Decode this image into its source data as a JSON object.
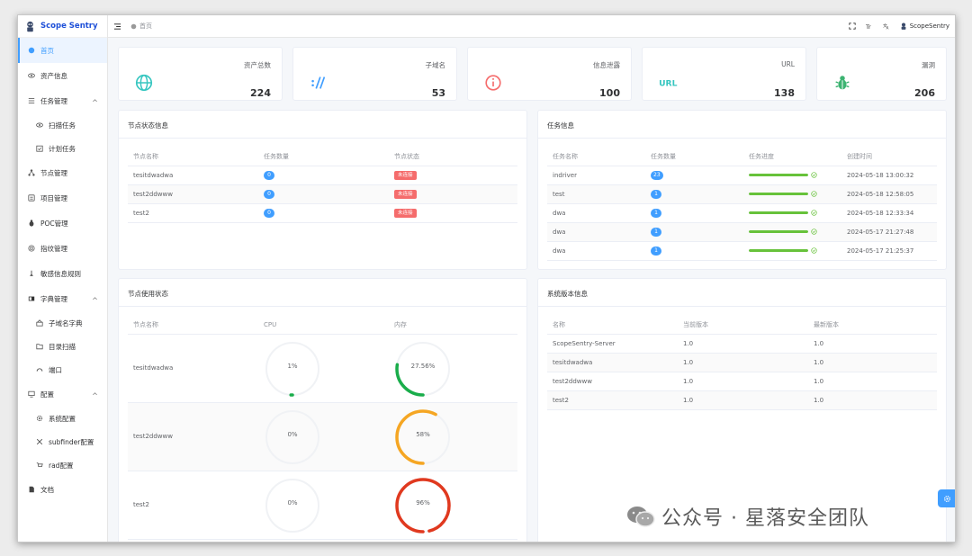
{
  "app": {
    "name": "Scope Sentry"
  },
  "sidebar": {
    "items": [
      {
        "label": "首页",
        "icon": "home-icon"
      },
      {
        "label": "资产信息",
        "icon": "eye-icon"
      },
      {
        "label": "任务管理",
        "icon": "list-icon"
      },
      {
        "label": "扫描任务",
        "icon": "eye-icon"
      },
      {
        "label": "计划任务",
        "icon": "calendar-check-icon"
      },
      {
        "label": "节点管理",
        "icon": "nodes-icon"
      },
      {
        "label": "项目管理",
        "icon": "project-icon"
      },
      {
        "label": "POC管理",
        "icon": "bug-icon"
      },
      {
        "label": "指纹管理",
        "icon": "fingerprint-icon"
      },
      {
        "label": "敏感信息规则",
        "icon": "rule-icon"
      },
      {
        "label": "字典管理",
        "icon": "dictionary-icon"
      },
      {
        "label": "子域名字典",
        "icon": "subdomain-dict-icon"
      },
      {
        "label": "目录扫描",
        "icon": "folder-icon"
      },
      {
        "label": "端口",
        "icon": "port-icon"
      },
      {
        "label": "配置",
        "icon": "monitor-icon"
      },
      {
        "label": "系统配置",
        "icon": "gear-icon"
      },
      {
        "label": "subfinder配置",
        "icon": "tools-icon"
      },
      {
        "label": "rad配置",
        "icon": "cart-icon"
      },
      {
        "label": "文档",
        "icon": "document-icon"
      }
    ]
  },
  "header": {
    "breadcrumb": "首页",
    "username": "ScopeSentry"
  },
  "stats": [
    {
      "label": "资产总数",
      "value": "224",
      "icon": "globe-icon",
      "color": "#36c6c0"
    },
    {
      "label": "子域名",
      "value": "53",
      "icon": "subdomain-icon",
      "color": "#409eff"
    },
    {
      "label": "信息泄露",
      "value": "100",
      "icon": "info-circle-icon",
      "color": "#f56c6c"
    },
    {
      "label": "URL",
      "value": "138",
      "icon": "url-icon",
      "color": "#36c6c0"
    },
    {
      "label": "漏洞",
      "value": "206",
      "icon": "bug-icon",
      "color": "#3cb371"
    }
  ],
  "node_status": {
    "title": "节点状态信息",
    "columns": [
      "节点名称",
      "任务数量",
      "节点状态"
    ],
    "rows": [
      {
        "name": "tesitdwadwa",
        "count": "0",
        "status": "未连接"
      },
      {
        "name": "test2ddwww",
        "count": "0",
        "status": "未连接"
      },
      {
        "name": "test2",
        "count": "0",
        "status": "未连接"
      }
    ]
  },
  "task_info": {
    "title": "任务信息",
    "columns": [
      "任务名称",
      "任务数量",
      "任务进度",
      "创建时间"
    ],
    "rows": [
      {
        "name": "indriver",
        "count": "23",
        "progress": 1.0,
        "time": "2024-05-18 13:00:32"
      },
      {
        "name": "test",
        "count": "1",
        "progress": 1.0,
        "time": "2024-05-18 12:58:05"
      },
      {
        "name": "dwa",
        "count": "1",
        "progress": 1.0,
        "time": "2024-05-18 12:33:34"
      },
      {
        "name": "dwa",
        "count": "1",
        "progress": 1.0,
        "time": "2024-05-17 21:27:48"
      },
      {
        "name": "dwa",
        "count": "1",
        "progress": 1.0,
        "time": "2024-05-17 21:25:37"
      }
    ]
  },
  "node_usage": {
    "title": "节点使用状态",
    "columns": [
      "节点名称",
      "CPU",
      "内存"
    ],
    "rows": [
      {
        "name": "tesitdwadwa",
        "cpu": 1,
        "cpu_text": "1%",
        "mem": 27.56,
        "mem_text": "27.56%"
      },
      {
        "name": "test2ddwww",
        "cpu": 0,
        "cpu_text": "0%",
        "mem": 58,
        "mem_text": "58%"
      },
      {
        "name": "test2",
        "cpu": 0,
        "cpu_text": "0%",
        "mem": 96,
        "mem_text": "96%"
      }
    ],
    "colors": {
      "low": "#1aad4b",
      "mid": "#f5a623",
      "high": "#e0391f",
      "track": "#f0f2f5"
    }
  },
  "versions": {
    "title": "系统版本信息",
    "columns": [
      "名称",
      "当前版本",
      "最新版本"
    ],
    "rows": [
      {
        "name": "ScopeSentry-Server",
        "current": "1.0",
        "latest": "1.0"
      },
      {
        "name": "tesitdwadwa",
        "current": "1.0",
        "latest": "1.0"
      },
      {
        "name": "test2ddwww",
        "current": "1.0",
        "latest": "1.0"
      },
      {
        "name": "test2",
        "current": "1.0",
        "latest": "1.0"
      }
    ]
  },
  "watermark": {
    "text": "公众号 · 星落安全团队"
  },
  "theme": {
    "accent": "#409eff",
    "success": "#67c23a",
    "danger": "#f56c6c"
  }
}
